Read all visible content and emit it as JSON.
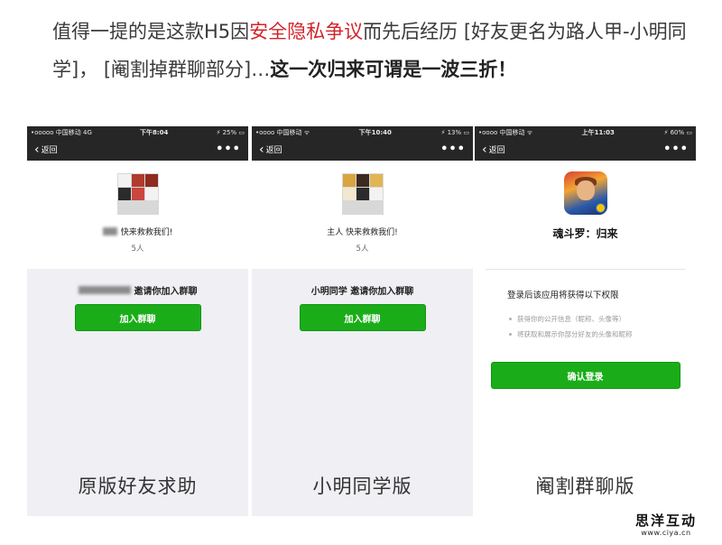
{
  "headline": {
    "part1": "值得一提的是这款H5因",
    "highlight": "安全隐私争议",
    "part2": "而先后经历 [好友更名为路人甲-小明同学]， [阉割掉群聊部分]…",
    "bold": "这一次归来可谓是一波三折！"
  },
  "phones": [
    {
      "status": {
        "left": "•ooooo 中国移动  4G",
        "time": "下午8:04",
        "right": "⚡ 25% ▭"
      },
      "back_label": "返回",
      "more_label": "•••",
      "group_name": "快来救救我们!",
      "member_count": "5人",
      "invite_text": "邀请你加入群聊",
      "join_label": "加入群聊",
      "caption": "原版好友求助",
      "avatar_colors": [
        "#f2f2f2",
        "#b03a2e",
        "#8d2b1f",
        "#2b2b2b",
        "#c9473d",
        "#f2f2f2"
      ]
    },
    {
      "status": {
        "left": "•oooo 中国移动 ᯤ",
        "time": "下午10:40",
        "right": "⚡ 13% ▭"
      },
      "back_label": "返回",
      "more_label": "•••",
      "group_name": "主人 快来救救我们!",
      "member_count": "5人",
      "invite_text": "小明同学 邀请你加入群聊",
      "join_label": "加入群聊",
      "caption": "小明同学版",
      "avatar_colors": [
        "#d9a441",
        "#3b2a1e",
        "#e0b552",
        "#f2e7cf",
        "#2b2b2b",
        "#f2f2f2"
      ]
    },
    {
      "status": {
        "left": "•oooo 中国移动 ᯤ",
        "time": "上午11:03",
        "right": "⚡ 60% ▭"
      },
      "back_label": "返回",
      "more_label": "•••",
      "app_name": "魂斗罗：归来",
      "perm_title": "登录后该应用将获得以下权限",
      "permissions": [
        "获得你的公开信息（昵称、头像等）",
        "将获取和展示你部分好友的头像和昵称"
      ],
      "confirm_label": "确认登录",
      "caption": "阉割群聊版"
    }
  ],
  "watermark": {
    "name": "思洋互动",
    "url": "www.ciya.cn"
  }
}
